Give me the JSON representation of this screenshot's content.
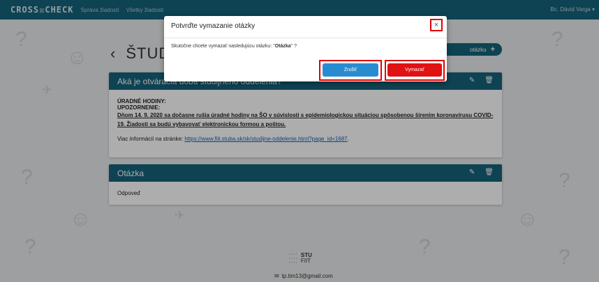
{
  "navbar": {
    "brand": "CROSS☒CHECK",
    "links": [
      "Správa žiadostí",
      "Všetky žiadosti"
    ],
    "user": "Bc. Dávid Varga ▾"
  },
  "page": {
    "title": "ŠTUDI",
    "add_question_label": "otázku"
  },
  "cards": [
    {
      "title": "Aká je otváracia doba študijného oddelenia?",
      "lines": {
        "hours": "ÚRADNÉ HODINY:",
        "notice": "UPOZORNENIE:",
        "notice_text": "Dňom 14. 9. 2020 sa dočasne rušia úradné hodiny na ŠO v súvislosti s epidemiologickou situáciou spôsobenou šírením koronavírusu COVID-19. Žiadosti sa budú vybavovať elektronickou formou a poštou.",
        "more_prefix": "Viac informácií na stránke:",
        "more_link": "https://www.fiit.stuba.sk/sk/studijne-oddelenie.html?page_id=1687",
        "more_suffix": "."
      }
    },
    {
      "title": "Otázka",
      "body": "Odpoveď"
    }
  ],
  "modal": {
    "title": "Potvrďte vymazanie otázky",
    "text_prefix": "Skutočne chcete vymazať nasledujúcu otázku: \"",
    "text_bold": "Otázka",
    "text_suffix": "\" ?",
    "cancel_label": "Zrušiť",
    "delete_label": "Vymazať",
    "close_label": "×"
  },
  "footer": {
    "logo_top": "STU",
    "logo_bottom": "FIIT",
    "email": "tp.tim13@gmail.com"
  },
  "colors": {
    "primary": "#16637b",
    "cancel": "#2a8cd0",
    "delete": "#e01212",
    "highlight": "#e00000"
  }
}
